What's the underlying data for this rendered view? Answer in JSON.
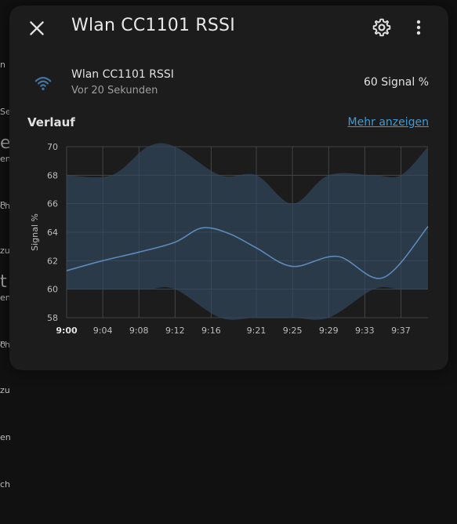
{
  "background": {
    "fragments": [
      "n",
      "Se",
      "en",
      "ch"
    ],
    "fragments2": [
      "n",
      "zu",
      "en",
      "ch"
    ],
    "fragments3": [
      "n",
      "zu",
      "en",
      "ch"
    ],
    "big1": "e",
    "big2": "t"
  },
  "dialog": {
    "title": "Wlan CC1101 RSSI",
    "entity": {
      "name": "Wlan CC1101 RSSI",
      "last_changed": "Vor 20 Sekunden",
      "state": "60 Signal %",
      "icon": "wifi-icon"
    },
    "history": {
      "label": "Verlauf",
      "more_link": "Mehr anzeigen"
    }
  },
  "colors": {
    "accent": "#3b9bd9",
    "line": "#5b8ab8",
    "band": "#2d3e4f",
    "dialog_bg": "#1c1c1c"
  },
  "chart_data": {
    "type": "line",
    "ylabel": "Signal %",
    "xlabel": "",
    "ylim": [
      58,
      70
    ],
    "y_ticks": [
      58,
      60,
      62,
      64,
      66,
      68,
      70
    ],
    "x_ticks": [
      "9:00",
      "9:04",
      "9:08",
      "9:12",
      "9:16",
      "9:21",
      "9:25",
      "9:29",
      "9:33",
      "9:37"
    ],
    "grid": true,
    "series": [
      {
        "role": "mean",
        "x": [
          "9:00",
          "9:04",
          "9:08",
          "9:12",
          "9:15",
          "9:18",
          "9:21",
          "9:25",
          "9:30",
          "9:35",
          "9:40"
        ],
        "values": [
          61.3,
          62.0,
          62.6,
          63.3,
          64.3,
          63.9,
          62.9,
          61.6,
          62.3,
          60.8,
          64.4
        ]
      },
      {
        "role": "max",
        "x": [
          "9:00",
          "9:05",
          "9:09",
          "9:12",
          "9:17",
          "9:21",
          "9:25",
          "9:29",
          "9:34",
          "9:37",
          "9:40"
        ],
        "values": [
          68,
          68,
          70,
          70,
          68,
          68,
          66,
          68,
          68,
          68,
          70
        ]
      },
      {
        "role": "min",
        "x": [
          "9:00",
          "9:05",
          "9:09",
          "9:12",
          "9:17",
          "9:21",
          "9:25",
          "9:29",
          "9:34",
          "9:37",
          "9:40"
        ],
        "values": [
          60,
          60,
          60,
          60,
          58,
          58,
          58,
          58,
          60,
          60,
          60
        ]
      }
    ]
  }
}
